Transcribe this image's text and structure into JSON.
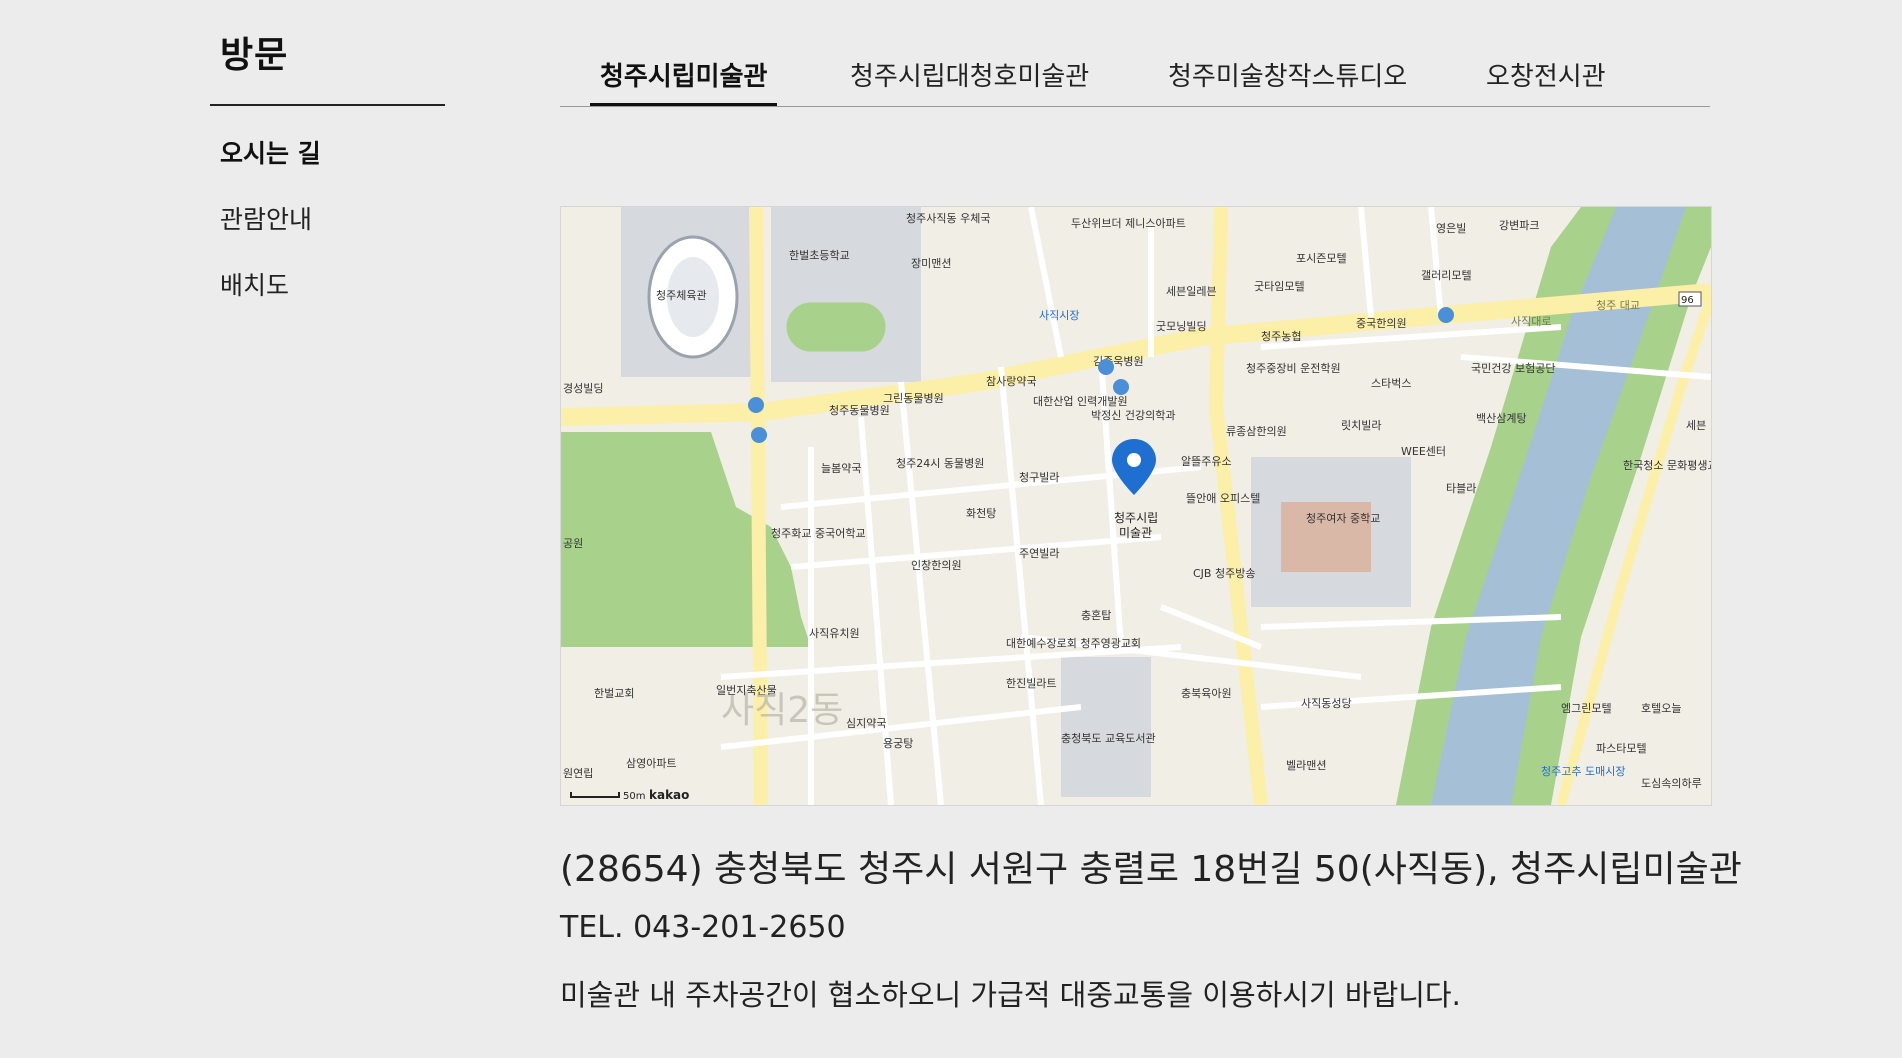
{
  "sidebar": {
    "title": "방문",
    "items": [
      {
        "label": "오시는 길",
        "active": true
      },
      {
        "label": "관람안내",
        "active": false
      },
      {
        "label": "배치도",
        "active": false
      }
    ]
  },
  "tabs": [
    {
      "label": "청주시립미술관",
      "active": true
    },
    {
      "label": "청주시립대청호미술관",
      "active": false
    },
    {
      "label": "청주미술창작스튜디오",
      "active": false
    },
    {
      "label": "오창전시관",
      "active": false
    }
  ],
  "map": {
    "marker_label_1": "청주시립",
    "marker_label_2": "미술관",
    "scale_label": "50m",
    "provider": "kakao",
    "watermark": "사직2동",
    "route_badge": "96",
    "places": {
      "stadium": "청주체육관",
      "school1": "한벌초등학교",
      "market": "사직시장",
      "apt": "두산위브더 제니스아파트",
      "motel1": "포시즌모텔",
      "motel2": "갤러리모텔",
      "motel3": "굿타임모텔",
      "goodmorning": "굿모닝빌딩",
      "post": "청주사직동 우체국",
      "mansion": "장미맨션",
      "seven": "세븐일레븐",
      "nh": "청주농협",
      "chinese": "중국한의원",
      "hospital1": "그린동물병원",
      "hospital2": "참사랑약국",
      "hospital3": "청주24시 동물병원",
      "pharm": "늘봄약국",
      "kyungsung": "경성빌딩",
      "bridge": "청주 대교",
      "road": "사직대로",
      "starbucks": "스타벅스",
      "nhis": "국민건강 보험공단",
      "driving": "청주중장비 운전학원",
      "ryu": "류종삼한의원",
      "rich": "릿치빌라",
      "wee": "WEE센터",
      "girls": "청주여자 중학교",
      "cjb": "CJB 청주방송",
      "officetel": "뜰안애 오피스텔",
      "gas": "알뜰주유소",
      "church1": "대한예수장로회 청주영광교회",
      "tower": "충혼탑",
      "villa1": "청구빌라",
      "villa2": "주연빌라",
      "villa3": "한진빌라트",
      "library": "충청북도 교육도서관",
      "kinder": "사직유치원",
      "church2": "한벌교회",
      "pharm2": "심지약국",
      "bath": "용궁탕",
      "bath2": "화천탕",
      "sam": "삼영아파트",
      "won": "원연립",
      "chinese_school": "청주화교 중국어학교",
      "inchang": "인창한의원",
      "ilbeon": "일번지축산물",
      "villa4": "벨라맨션",
      "sajik_sung": "사직동성당",
      "ed_center": "충북육아원",
      "motel4": "엠그린모텔",
      "motel5": "호텔오늘",
      "motel6": "파스타모텔",
      "dosim": "도심속의하루",
      "market2": "청주고추 도매시장",
      "baeksan": "백산삼계탕",
      "tabella": "타블라",
      "youth": "한국청소 문화평생교",
      "sebin": "세븐",
      "yeongeun": "영은빌",
      "gangbyeon": "강변파크",
      "park": "공원",
      "dh_labor": "대한산업 인력개발원",
      "park_clinic": "박정신 건강의학과",
      "cheongju_bong": "청주동물병원",
      "kim": "김종욱병원"
    }
  },
  "contact": {
    "address": "(28654) 충청북도 청주시 서원구 충렬로 18번길 50(사직동), 청주시립미술관",
    "tel": "TEL. 043-201-2650",
    "note": "미술관 내 주차공간이 협소하오니 가급적 대중교통을 이용하시기 바랍니다."
  },
  "colors": {
    "background": "#ececec",
    "map_land": "#f1eee6",
    "map_road_major": "#fcefa8",
    "map_green": "#a8d28c",
    "map_river": "#a5bfd6",
    "map_block": "#d6d9de",
    "marker": "#1f6fd1"
  }
}
